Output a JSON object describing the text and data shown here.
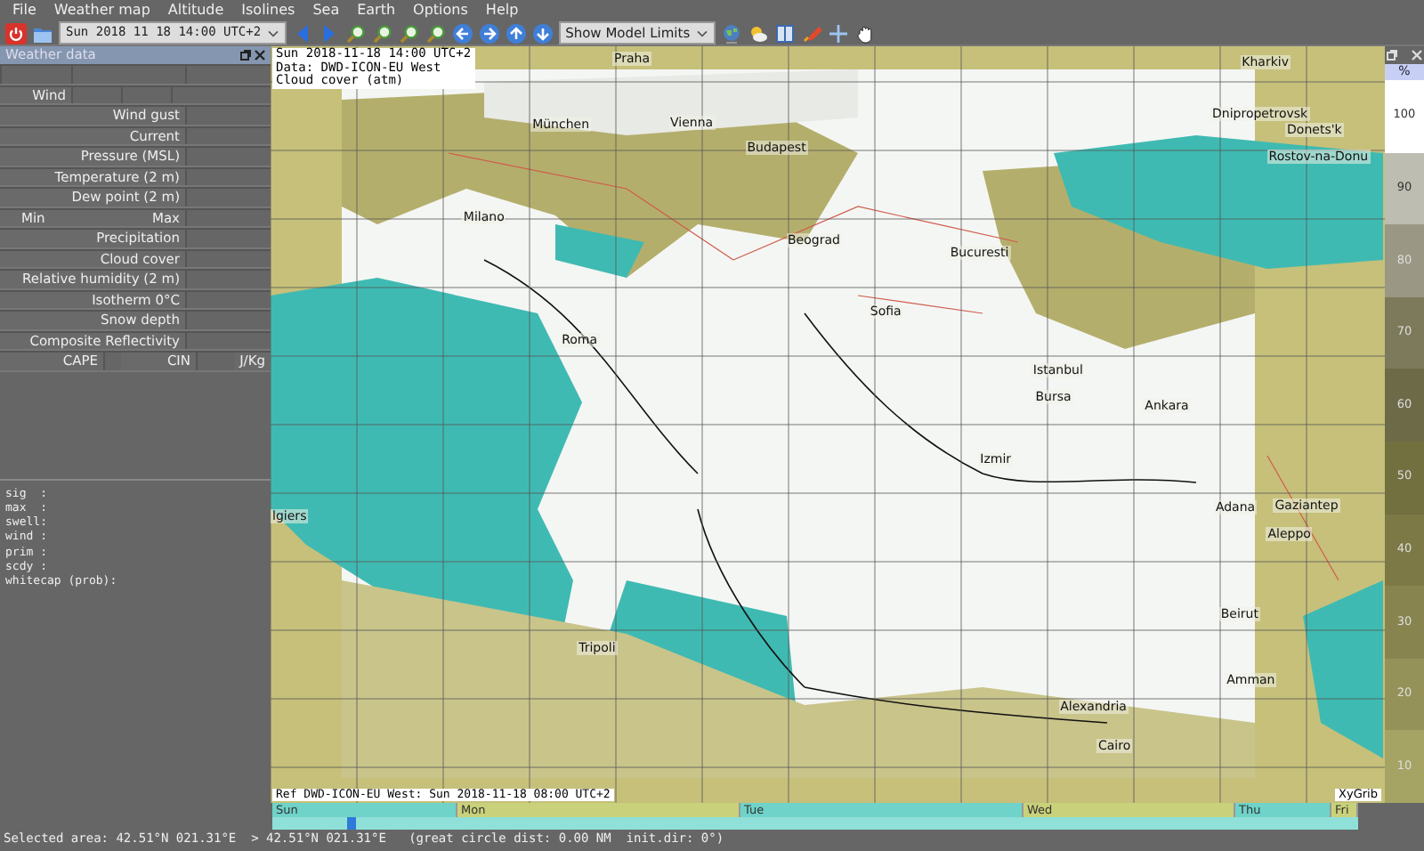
{
  "menu": [
    "File",
    "Weather map",
    "Altitude",
    "Isolines",
    "Sea",
    "Earth",
    "Options",
    "Help"
  ],
  "toolbar": {
    "date_combo": "Sun 2018 11 18 14:00 UTC+2",
    "limits_combo": "Show Model Limits"
  },
  "weather_panel": {
    "title": "Weather data",
    "rows": [
      {
        "kind": "blank"
      },
      {
        "kind": "wind",
        "label": "Wind"
      },
      {
        "kind": "field",
        "label": "Wind gust"
      },
      {
        "kind": "field",
        "label": "Current"
      },
      {
        "kind": "field",
        "label": "Pressure (MSL)"
      },
      {
        "kind": "field",
        "label": "Temperature (2 m)"
      },
      {
        "kind": "field",
        "label": "Dew point (2 m)"
      },
      {
        "kind": "minmax",
        "label": "Min",
        "label_2": "Max"
      },
      {
        "kind": "field",
        "label": "Precipitation"
      },
      {
        "kind": "field",
        "label": "Cloud cover"
      },
      {
        "kind": "field",
        "label": "Relative humidity (2 m)"
      },
      {
        "kind": "field",
        "label": "Isotherm 0°C"
      },
      {
        "kind": "field",
        "label": "Snow depth"
      },
      {
        "kind": "field",
        "label": "Composite Reflectivity"
      },
      {
        "kind": "cape",
        "label": "CAPE",
        "label_2": "CIN",
        "label_3": "J/Kg"
      }
    ]
  },
  "wave_panel": [
    "sig  :",
    "max  :",
    "swell:",
    "wind :",
    "prim :",
    "scdy :",
    "whitecap (prob):"
  ],
  "map": {
    "header": [
      "Sun 2018-11-18 14:00 UTC+2",
      "Data: DWD-ICON-EU West",
      "Cloud cover (atm)"
    ],
    "reference": "Ref DWD-ICON-EU West: Sun 2018-11-18 08:00 UTC+2",
    "brand": "XyGrib",
    "cities": [
      "Praha",
      "Kharkiv",
      "München",
      "Vienna",
      "Dnipropetrovsk",
      "Donets'k",
      "Budapest",
      "Rostov-na-Donu",
      "Milano",
      "Beograd",
      "Bucuresti",
      "Sofia",
      "Roma",
      "Istanbul",
      "Bursa",
      "Ankara",
      "Izmir",
      "Adana",
      "Gaziantep",
      "Aleppo",
      "lgiers",
      "Tripoli",
      "Beirut",
      "Amman",
      "Alexandria",
      "Cairo"
    ]
  },
  "legend": {
    "unit": "%",
    "bands": [
      {
        "label": "100",
        "color": "#ffffff"
      },
      {
        "label": "90",
        "color": "#bebdb1"
      },
      {
        "label": "80",
        "color": "#9a9884"
      },
      {
        "label": "70",
        "color": "#7c7a5a"
      },
      {
        "label": "60",
        "color": "#6d6a48"
      },
      {
        "label": "50",
        "color": "#72703f"
      },
      {
        "label": "40",
        "color": "#7c7947"
      },
      {
        "label": "30",
        "color": "#878450"
      },
      {
        "label": "20",
        "color": "#959259"
      },
      {
        "label": "10",
        "color": "#a6a464"
      }
    ]
  },
  "timeline": {
    "level": 0.072,
    "days": [
      {
        "label": "Sun",
        "color": "#6fd3c9"
      },
      {
        "label": "Mon",
        "color": "#c9d27a"
      },
      {
        "label": "Tue",
        "color": "#6fd3c9"
      },
      {
        "label": "Wed",
        "color": "#c9d27a"
      },
      {
        "label": "Thu",
        "color": "#6fd3c9"
      },
      {
        "label": "Fri",
        "color": "#c9d27a"
      }
    ]
  },
  "status_bar": "Selected area: 42.51°N 021.31°E  > 42.51°N 021.31°E   (great circle dist: 0.00 NM  init.dir: 0°)"
}
